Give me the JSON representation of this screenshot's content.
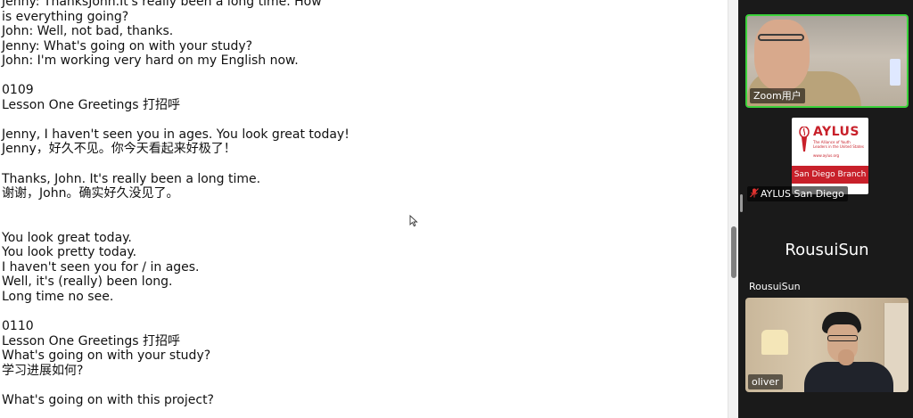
{
  "document": {
    "lines": [
      "Jenny: ThanksJohn.It's really been a long time. How",
      "is everything going?",
      "John: Well, not bad, thanks.",
      "Jenny: What's going on with your study?",
      "John: I'm working very hard on my English now.",
      "",
      "0109",
      "Lesson One Greetings 打招呼",
      "",
      "Jenny, I haven't seen you in ages. You look great today!",
      "Jenny，好久不见。你今天看起来好极了！",
      "",
      "Thanks, John. It's really been a long time.",
      "谢谢，John。确实好久没见了。",
      "",
      "",
      "You look great today.",
      "You look pretty today.",
      "I haven't seen you for / in ages.",
      "Well, it's (really) been long.",
      "Long time no see.",
      "",
      "0110",
      "Lesson One Greetings 打招呼",
      "What's going on with your study?",
      "学习进展如何?",
      "",
      "What's going on with this project?"
    ]
  },
  "zoom_panel": {
    "participants": [
      {
        "name": "Zoom用户",
        "active_speaker": true
      },
      {
        "name": "AYLUS San Diego",
        "muted": true
      },
      {
        "name": "RousuiSun",
        "video_off": true
      },
      {
        "name": "oliver"
      }
    ],
    "aylus_logo": {
      "title": "AYLUS",
      "subtitle": "The Alliance of Youth Leaders in the United States",
      "url": "www.aylus.org",
      "branch": "San Diego Branch"
    }
  },
  "colors": {
    "active_border": "#3bd23b",
    "panel_bg": "#1a1a1a",
    "aylus_red": "#c8202a"
  }
}
